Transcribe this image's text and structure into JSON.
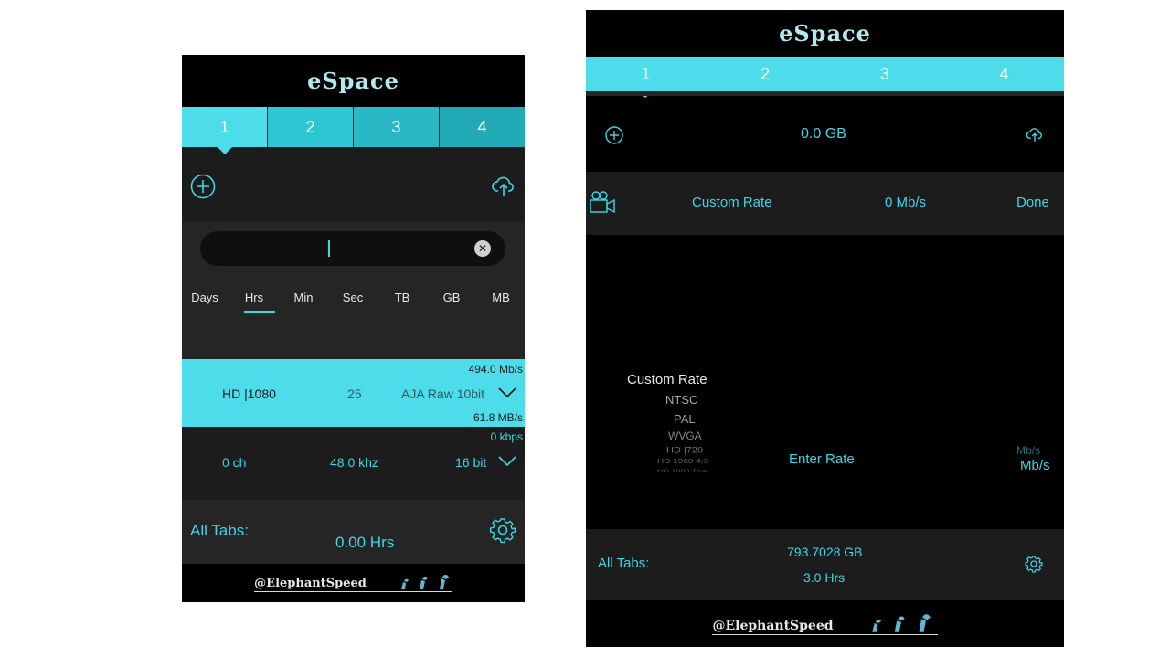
{
  "left": {
    "title": "eSpace",
    "tabs": [
      "1",
      "2",
      "3",
      "4"
    ],
    "units": [
      "Days",
      "Hrs",
      "Min",
      "Sec",
      "TB",
      "GB",
      "MB"
    ],
    "selected_unit": "Hrs",
    "input_value": "",
    "video": {
      "format": "HD |1080",
      "fps": "25",
      "codec": "AJA Raw 10bit",
      "bitrate_top": "494.0 Mb/s",
      "bitrate_bottom": "61.8 MB/s"
    },
    "audio": {
      "channels": "0 ch",
      "sample_rate": "48.0 khz",
      "bit_depth": "16 bit",
      "rate": "0 kbps"
    },
    "all_tabs_label": "All Tabs:",
    "total": "0.00 Hrs",
    "brand": "@ElephantSpeed"
  },
  "right": {
    "title": "eSpace",
    "tabs": [
      "1",
      "2",
      "3",
      "4"
    ],
    "storage": "0.0 GB",
    "custom_rate_label": "Custom Rate",
    "rate_value": "0 Mb/s",
    "done_label": "Done",
    "picker": [
      "Custom Rate",
      "NTSC",
      "PAL",
      "WVGA",
      "HD |720",
      "HD 1960 4:3",
      "HD 1080 True"
    ],
    "enter_rate": "Enter Rate",
    "unit_faded": "Mb/s",
    "unit": "Mb/s",
    "all_tabs_label": "All Tabs:",
    "total_gb": "793.7028 GB",
    "total_hrs": "3.0 Hrs",
    "brand": "@ElephantSpeed"
  },
  "colors": {
    "accent": "#3dd6e4",
    "background": "#1c1c1c",
    "bar": "#000000"
  }
}
